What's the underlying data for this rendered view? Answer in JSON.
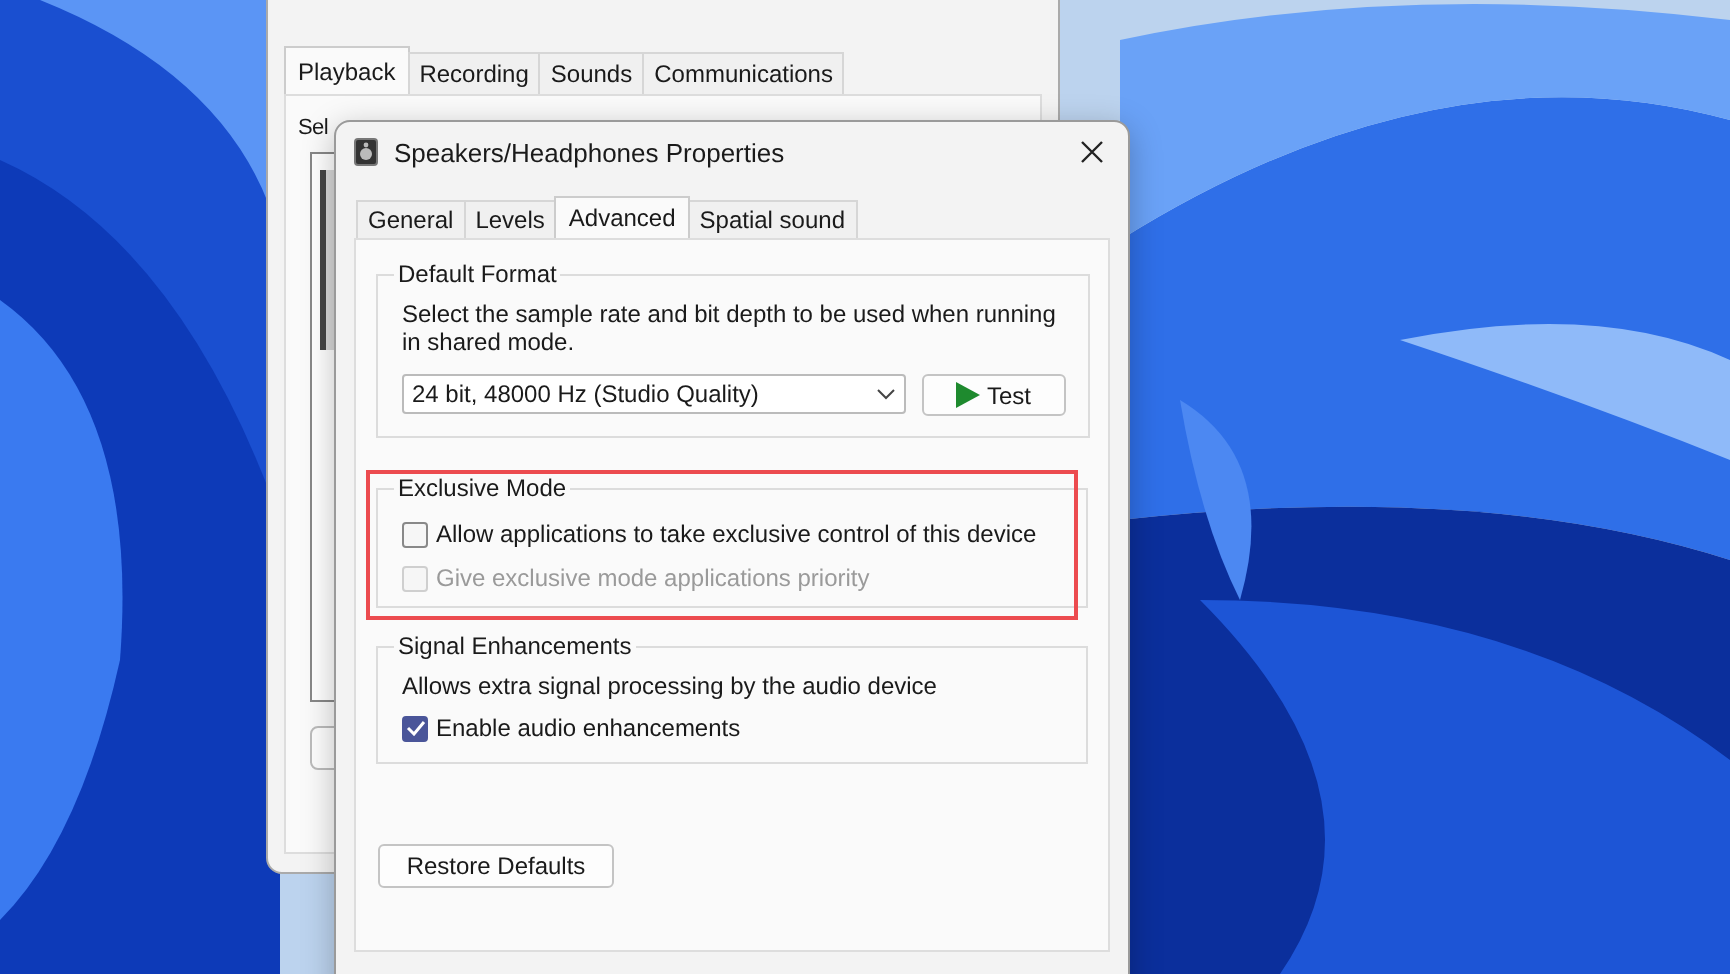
{
  "background_window": {
    "tabs": [
      {
        "label": "Playback",
        "selected": true
      },
      {
        "label": "Recording",
        "selected": false
      },
      {
        "label": "Sounds",
        "selected": false
      },
      {
        "label": "Communications",
        "selected": false
      }
    ],
    "instruction": "Sel"
  },
  "dialog": {
    "title": "Speakers/Headphones Properties",
    "tabs": [
      {
        "label": "General",
        "selected": false
      },
      {
        "label": "Levels",
        "selected": false
      },
      {
        "label": "Advanced",
        "selected": true
      },
      {
        "label": "Spatial sound",
        "selected": false
      }
    ],
    "default_format": {
      "heading": "Default Format",
      "description": "Select the sample rate and bit depth to be used when running in shared mode.",
      "format_value": "24 bit, 48000 Hz (Studio Quality)",
      "test_button": "Test"
    },
    "exclusive_mode": {
      "heading": "Exclusive Mode",
      "options": [
        {
          "label": "Allow applications to take exclusive control of this device",
          "checked": false,
          "disabled": false
        },
        {
          "label": "Give exclusive mode applications priority",
          "checked": false,
          "disabled": true
        }
      ]
    },
    "signal_enhancements": {
      "heading": "Signal Enhancements",
      "description": "Allows extra signal processing by the audio device",
      "options": [
        {
          "label": "Enable audio enhancements",
          "checked": true,
          "disabled": false
        }
      ]
    },
    "restore_button": "Restore Defaults"
  }
}
